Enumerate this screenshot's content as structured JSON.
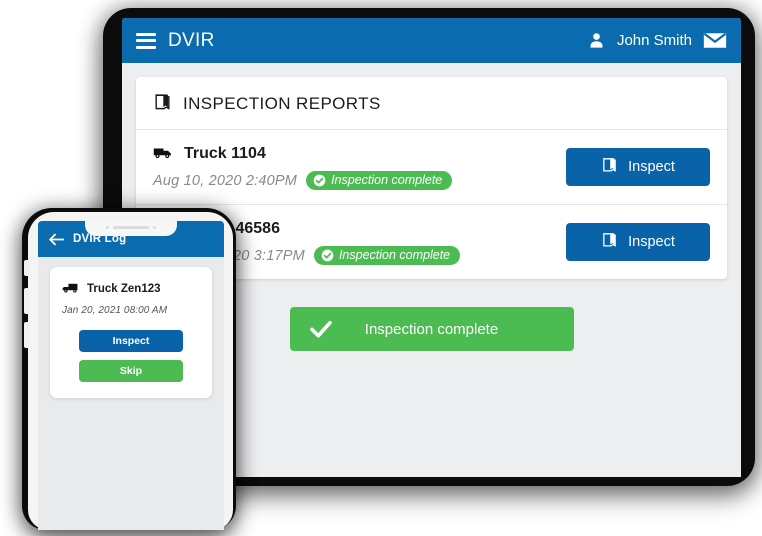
{
  "tablet": {
    "topbar": {
      "menu_icon": "hamburger-menu-icon",
      "title": "DVIR",
      "user_icon": "person-icon",
      "user_name": "John Smith",
      "mail_icon": "envelope-icon"
    },
    "card": {
      "header_icon": "book-icon",
      "header_title": "INSPECTION REPORTS",
      "rows": [
        {
          "icon": "truck-icon",
          "title": "Truck 1104",
          "date": "Aug 10, 2020 2:40PM",
          "badge": "Inspection complete",
          "badge_icon": "check-circle-icon",
          "button_label": "Inspect",
          "button_icon": "book-icon"
        },
        {
          "icon": "trailer-icon",
          "title": "Trailer 46586",
          "date": "20 3:17PM",
          "badge": "Inspection complete",
          "badge_icon": "check-circle-icon",
          "button_label": "Inspect",
          "button_icon": "book-icon"
        }
      ]
    },
    "cta": {
      "label": "Inspection complete",
      "icon": "checkmark-icon"
    }
  },
  "phone": {
    "topbar": {
      "back_icon": "back-arrow-icon",
      "title": "DVIR Log"
    },
    "card": {
      "icon": "truck-icon",
      "title": "Truck Zen123",
      "date": "Jan 20, 2021 08:00 AM",
      "inspect_label": "Inspect",
      "skip_label": "Skip"
    }
  },
  "colors": {
    "brand_blue": "#0a6cae",
    "button_blue": "#0a63a8",
    "green": "#4cbb52",
    "screen_bg": "#eceef0",
    "frame_black": "#0b0b0b"
  }
}
